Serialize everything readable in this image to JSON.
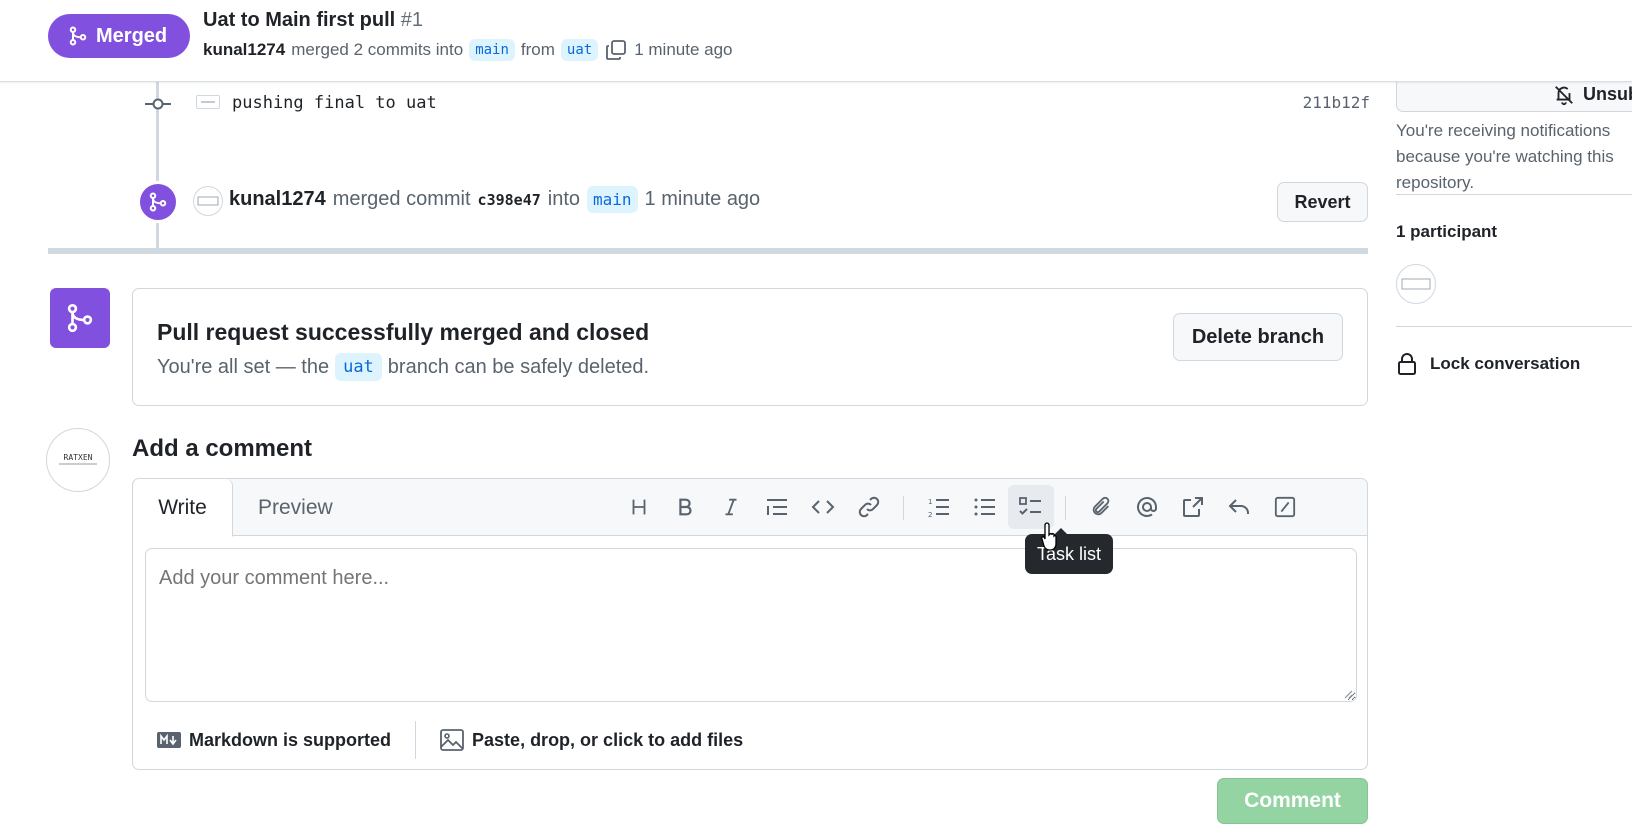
{
  "header": {
    "state_label": "Merged",
    "title": "Uat to Main first pull",
    "number": "#1",
    "author": "kunal1274",
    "merged_text": "merged 2 commits into",
    "base_branch": "main",
    "from_text": "from",
    "head_branch": "uat",
    "time": "1 minute ago"
  },
  "timeline": {
    "commit": {
      "message": "pushing final to uat",
      "sha": "211b12f"
    },
    "merge_event": {
      "author": "kunal1274",
      "action": "merged commit",
      "sha": "c398e47",
      "into": "into",
      "branch": "main",
      "time": "1 minute ago",
      "revert_label": "Revert"
    }
  },
  "merged_box": {
    "title": "Pull request successfully merged and closed",
    "sub_prefix": "You're all set — the",
    "branch": "uat",
    "sub_suffix": "branch can be safely deleted.",
    "delete_label": "Delete branch"
  },
  "comment": {
    "heading": "Add a comment",
    "tab_write": "Write",
    "tab_preview": "Preview",
    "placeholder": "Add your comment here...",
    "markdown_label": "Markdown is supported",
    "attach_label": "Paste, drop, or click to add files",
    "tooltip": "Task list",
    "submit_label": "Comment",
    "toolbar_icons": [
      "heading-icon",
      "bold-icon",
      "italic-icon",
      "quote-icon",
      "code-icon",
      "link-icon",
      "numbered-list-icon",
      "unordered-list-icon",
      "task-list-icon",
      "attach-icon",
      "mention-icon",
      "cross-reference-icon",
      "saved-reply-icon",
      "slash-commands-icon"
    ]
  },
  "sidebar": {
    "unsubscribe_label": "Unsubscribe",
    "notification_text": "You're receiving notifications because you're watching this repository.",
    "participants_heading": "1 participant",
    "lock_label": "Lock conversation"
  },
  "avatar_text": "RATXEN",
  "colors": {
    "merged_purple": "#8250df",
    "branch_blue": "#0969da",
    "branch_bg": "#ddf4ff",
    "submit_green_disabled": "#94d3a2"
  }
}
